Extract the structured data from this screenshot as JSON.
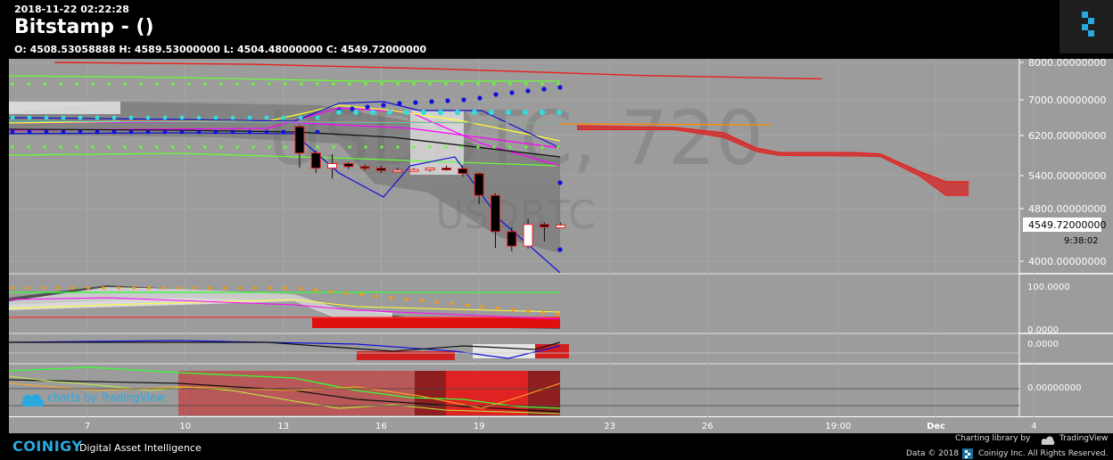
{
  "header": {
    "timestamp": "2018-11-22 02:22:28",
    "exchange_title": "Bitstamp -  ()",
    "ohlc_text": "O: 4508.53058888 H: 4589.53000000 L: 4504.48000000 C: 4549.72000000"
  },
  "watermark": {
    "big": "USDBTC, 720",
    "small": "USDBTC"
  },
  "badge": "charts by TradingView",
  "footer": {
    "brand": "COINIGY",
    "tagline": "Digital Asset Intelligence",
    "charting_library": "Charting library by",
    "tradingview": "TradingView",
    "data_year": "Data © 2018",
    "rights": "Coinigy Inc. All Rights Reserved."
  },
  "colors": {
    "plot_bg": "#9c9c9c",
    "candle_up": "#ffffff",
    "candle_down": "#000000",
    "candle_border": "#e8201e",
    "cloud": "#d03030",
    "ema": "#e8201e",
    "bollinger": "#ff00ff",
    "keltner": "#1010d8",
    "envelope": "#66ff33",
    "brand": "#29a9e0"
  },
  "chart_data": {
    "type": "candlestick",
    "symbol": "USDBTC",
    "interval": "720",
    "exchange": "Bitstamp",
    "price_axis": {
      "ticks": [
        8000,
        7000,
        6200,
        5400,
        4800,
        4000
      ],
      "tick_labels": [
        "8000.00000000",
        "7000.00000000",
        "6200.00000000",
        "5400.00000000",
        "4800.00000000",
        "4000.00000000"
      ],
      "last_price_label": "4549.72000000",
      "countdown": "9:38:02"
    },
    "x_axis": {
      "ticks": [
        7,
        10,
        13,
        16,
        19,
        23,
        26,
        30,
        33,
        36
      ],
      "tick_labels": [
        "7",
        "10",
        "13",
        "16",
        "19",
        "23",
        "26",
        "19:00",
        "Dec",
        "4"
      ]
    },
    "candles": [
      {
        "x": 13.5,
        "o": 6400,
        "h": 6440,
        "l": 5560,
        "c": 5850
      },
      {
        "x": 14.0,
        "o": 5850,
        "h": 5900,
        "l": 5450,
        "c": 5550
      },
      {
        "x": 14.5,
        "o": 5550,
        "h": 5830,
        "l": 5350,
        "c": 5640
      },
      {
        "x": 15.0,
        "o": 5640,
        "h": 5670,
        "l": 5530,
        "c": 5580
      },
      {
        "x": 15.5,
        "o": 5580,
        "h": 5620,
        "l": 5500,
        "c": 5550
      },
      {
        "x": 16.0,
        "o": 5550,
        "h": 5600,
        "l": 5450,
        "c": 5500
      },
      {
        "x": 16.5,
        "o": 5500,
        "h": 5560,
        "l": 5470,
        "c": 5510
      },
      {
        "x": 17.0,
        "o": 5510,
        "h": 5550,
        "l": 5480,
        "c": 5520
      },
      {
        "x": 17.5,
        "o": 5520,
        "h": 5560,
        "l": 5480,
        "c": 5550
      },
      {
        "x": 18.0,
        "o": 5550,
        "h": 5600,
        "l": 5500,
        "c": 5540
      },
      {
        "x": 18.5,
        "o": 5540,
        "h": 5620,
        "l": 5380,
        "c": 5440
      },
      {
        "x": 19.0,
        "o": 5440,
        "h": 5460,
        "l": 4880,
        "c": 5040
      },
      {
        "x": 19.5,
        "o": 5040,
        "h": 5080,
        "l": 4200,
        "c": 4450
      },
      {
        "x": 20.0,
        "o": 4450,
        "h": 4520,
        "l": 4150,
        "c": 4230
      },
      {
        "x": 20.5,
        "o": 4230,
        "h": 4650,
        "l": 4190,
        "c": 4560
      },
      {
        "x": 21.0,
        "o": 4560,
        "h": 4590,
        "l": 4300,
        "c": 4520
      },
      {
        "x": 21.5,
        "o": 4508.53,
        "h": 4589.53,
        "l": 4504.48,
        "c": 4549.72
      }
    ],
    "cloud_upper": [
      [
        22,
        6420
      ],
      [
        25,
        6380
      ],
      [
        26.5,
        6260
      ],
      [
        27.5,
        5950
      ],
      [
        28.2,
        5860
      ],
      [
        30.5,
        5860
      ],
      [
        31.3,
        5830
      ],
      [
        32.5,
        5480
      ],
      [
        33.3,
        5290
      ],
      [
        34,
        5290
      ]
    ],
    "cloud_lower": [
      [
        22,
        6330
      ],
      [
        25,
        6330
      ],
      [
        26.5,
        6160
      ],
      [
        27.5,
        5880
      ],
      [
        28.2,
        5800
      ],
      [
        30.5,
        5790
      ],
      [
        31.3,
        5780
      ],
      [
        32.5,
        5390
      ],
      [
        33.3,
        5040
      ],
      [
        34,
        5040
      ]
    ],
    "ema_line": [
      [
        6,
        8000
      ],
      [
        12,
        7950
      ],
      [
        18,
        7820
      ],
      [
        24,
        7650
      ],
      [
        29.5,
        7560
      ]
    ],
    "panels": {
      "panel1_label": "100.0000",
      "panel1_zero": "0.0000",
      "panel2_label": "0.0000",
      "panel3_label": "0.00000000"
    },
    "grid": true
  }
}
